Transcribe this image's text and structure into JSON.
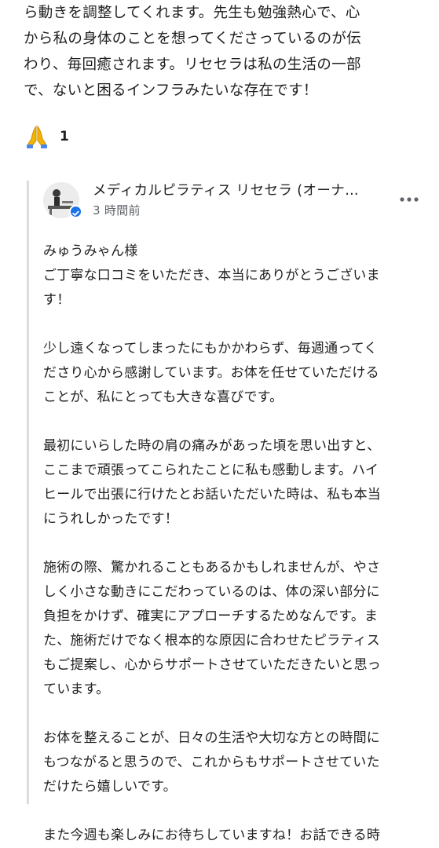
{
  "review": {
    "lines": [
      "ら動きを調整してくれます。先生も勉強熱心で、心",
      "から私の身体のことを想ってくださっているのが伝",
      "わり、毎回癒されます。リセセラは私の生活の一部",
      "で、ないと困るインフラみたいな存在です！"
    ]
  },
  "reaction": {
    "icon": "folded-hands-icon",
    "count": "1"
  },
  "reply": {
    "owner_name": "メディカルピラティス リセセラ (オーナ…",
    "time": "3 時間前",
    "verified_color": "#1a73e8",
    "lines": [
      "みゅうみゃん様",
      "ご丁寧な口コミをいただき、本当にありがとうございま",
      "す！",
      "",
      "少し遠くなってしまったにもかかわらず、毎週通ってく",
      "ださり心から感謝しています。お体を任せていただける",
      "ことが、私にとっても大きな喜びです。",
      "",
      "最初にいらした時の肩の痛みがあった頃を思い出すと、",
      "ここまで頑張ってこられたことに私も感動します。ハイ",
      "ヒールで出張に行けたとお話いただいた時は、私も本当",
      "にうれしかったです！",
      "",
      "施術の際、驚かれることもあるかもしれませんが、やさ",
      "しく小さな動きにこだわっているのは、体の深い部分に",
      "負担をかけず、確実にアプローチするためなんです。ま",
      "た、施術だけでなく根本的な原因に合わせたピラティス",
      "もご提案し、心からサポートさせていただきたいと思っ",
      "ています。",
      "",
      "お体を整えることが、日々の生活や大切な方との時間に",
      "もつながると思うので、これからもサポートさせていた",
      "だけたら嬉しいです。",
      "",
      "また今週も楽しみにお待ちしていますね！お話できる時"
    ]
  },
  "colors": {
    "text": "#1f1f1f",
    "secondary_text": "#5f6368",
    "thread_line": "#dadce0",
    "reaction_emoji": "#f4b400"
  }
}
